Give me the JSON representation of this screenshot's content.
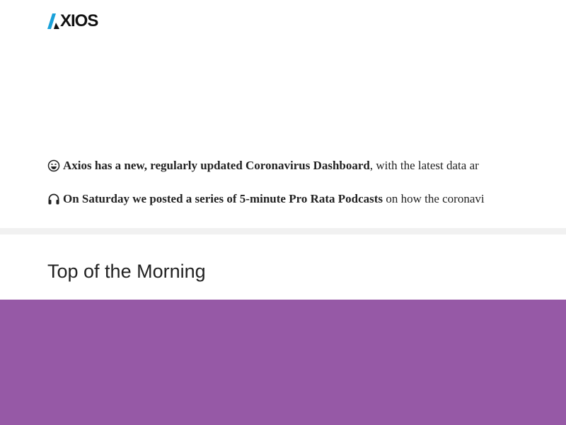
{
  "brand": {
    "logo_text": "XIOS",
    "accent_color": "#1aa1d9",
    "logo_color": "#111111"
  },
  "bullets": [
    {
      "icon": "smiling-face-icon",
      "link_text": "Axios has a new, regularly updated Coronavirus Dashboard",
      "rest_text": ", with the latest data ar"
    },
    {
      "icon": "headphones-icon",
      "link_text": "On Saturday we posted a series of 5-minute Pro Rata Podcasts",
      "rest_text": " on how the coronavi"
    }
  ],
  "section": {
    "title": "Top of the Morning"
  },
  "colors": {
    "divider": "#f1f1f1",
    "hero_background": "#9659a6",
    "text": "#222222"
  }
}
